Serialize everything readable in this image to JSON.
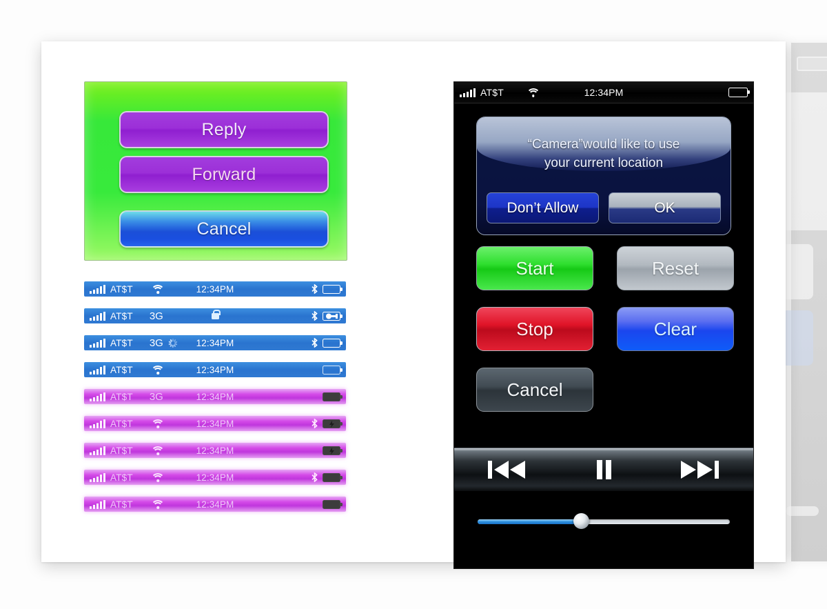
{
  "background_panel": {
    "battery_icon": "battery-icon"
  },
  "action_sheet": {
    "buttons": [
      {
        "label": "Reply",
        "name": "reply-button",
        "color": "#9c2fd8"
      },
      {
        "label": "Forward",
        "name": "forward-button",
        "color": "#9c2fd8"
      },
      {
        "label": "Cancel",
        "name": "cancel-button",
        "color": "#1b4fd8"
      }
    ],
    "background_color": "#38ea3c"
  },
  "status_bars": [
    {
      "theme": "blue",
      "carrier": "AT$T",
      "network": "",
      "wifi": true,
      "spinner": false,
      "lock": false,
      "time": "12:34PM",
      "bluetooth": true,
      "battery": "full-white"
    },
    {
      "theme": "blue",
      "carrier": "AT$T",
      "network": "3G",
      "wifi": false,
      "spinner": false,
      "lock": true,
      "time": "",
      "bluetooth": true,
      "battery": "charging-plug"
    },
    {
      "theme": "blue",
      "carrier": "AT$T",
      "network": "3G",
      "wifi": false,
      "spinner": true,
      "lock": false,
      "time": "12:34PM",
      "bluetooth": true,
      "battery": "low-green"
    },
    {
      "theme": "blue",
      "carrier": "AT$T",
      "network": "",
      "wifi": true,
      "spinner": false,
      "lock": false,
      "time": "12:34PM",
      "bluetooth": false,
      "battery": "faded-white"
    },
    {
      "theme": "pink",
      "carrier": "AT$T",
      "network": "3G",
      "wifi": false,
      "spinner": false,
      "lock": false,
      "time": "12:34PM",
      "bluetooth": false,
      "battery": "dark-green"
    },
    {
      "theme": "pink",
      "carrier": "AT$T",
      "network": "",
      "wifi": true,
      "spinner": false,
      "lock": false,
      "time": "12:34PM",
      "bluetooth": true,
      "battery": "dark-charging"
    },
    {
      "theme": "pink",
      "carrier": "AT$T",
      "network": "",
      "wifi": true,
      "spinner": false,
      "lock": false,
      "time": "12:34PM",
      "bluetooth": false,
      "battery": "dark-charging"
    },
    {
      "theme": "pink",
      "carrier": "AT$T",
      "network": "",
      "wifi": true,
      "spinner": false,
      "lock": false,
      "time": "12:34PM",
      "bluetooth": true,
      "battery": "dark-green"
    },
    {
      "theme": "pink",
      "carrier": "AT$T",
      "network": "",
      "wifi": true,
      "spinner": false,
      "lock": false,
      "time": "12:34PM",
      "bluetooth": false,
      "battery": "dark-green"
    }
  ],
  "phone": {
    "status_bar": {
      "carrier": "AT$T",
      "time": "12:34PM",
      "wifi_icon": "wifi-icon",
      "signal_icon": "signal-bars-icon",
      "battery_icon": "battery-full-icon"
    },
    "alert": {
      "message_line1": "“Camera”would like to use",
      "message_line2": "your current location",
      "deny_label": "Don’t Allow",
      "ok_label": "OK"
    },
    "buttons": [
      {
        "label": "Start",
        "name": "start-button",
        "color": "#2fdf2f"
      },
      {
        "label": "Reset",
        "name": "reset-button",
        "color": "#b2b9c0"
      },
      {
        "label": "Stop",
        "name": "stop-button",
        "color": "#e01428"
      },
      {
        "label": "Clear",
        "name": "clear-button",
        "color": "#1b46ee"
      },
      {
        "label": "Cancel",
        "name": "cancel-button",
        "color": "#414b53"
      }
    ],
    "media_controls": {
      "previous_icon": "skip-previous-icon",
      "pause_icon": "pause-icon",
      "next_icon": "skip-next-icon"
    },
    "slider": {
      "value_percent": 41,
      "accent_color": "#2e91e0"
    }
  }
}
